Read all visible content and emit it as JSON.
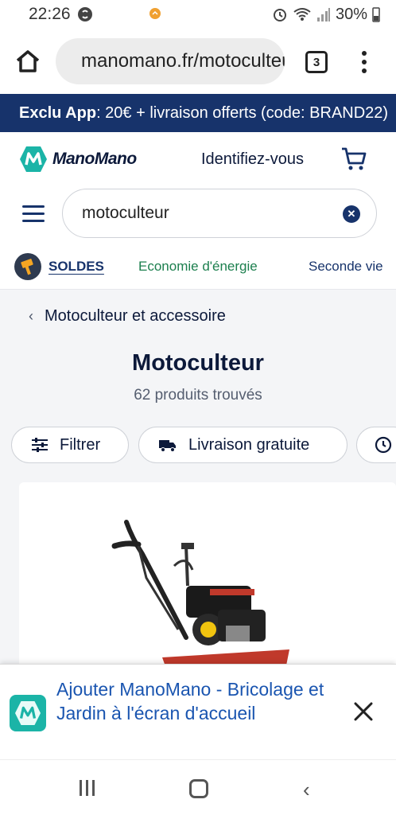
{
  "status": {
    "time": "22:26",
    "battery": "30%"
  },
  "browser": {
    "url": "manomano.fr/motoculteur",
    "tab_count": "3"
  },
  "promo": {
    "bold": "Exclu App",
    "text": " : 20€ + livraison offerts (code: BRAND22)"
  },
  "header": {
    "logo_text": "ManoMano",
    "login": "Identifiez-vous"
  },
  "search": {
    "value": "motoculteur"
  },
  "categories": [
    {
      "label": "SOLDES"
    },
    {
      "label": "Economie d'énergie"
    },
    {
      "label": "Seconde vie"
    }
  ],
  "page": {
    "breadcrumb": "Motoculteur et accessoire",
    "title": "Motoculteur",
    "count": "62 produits trouvés"
  },
  "filters": {
    "filter_label": "Filtrer",
    "delivery_label": "Livraison gratuite"
  },
  "install_banner": {
    "text": "Ajouter ManoMano - Bricolage et Jardin à l'écran d'accueil"
  },
  "colors": {
    "brand_dark": "#17336b",
    "brand_teal": "#1bb4a7",
    "eco_green": "#1c7f4e",
    "link_blue": "#1a55b0"
  }
}
